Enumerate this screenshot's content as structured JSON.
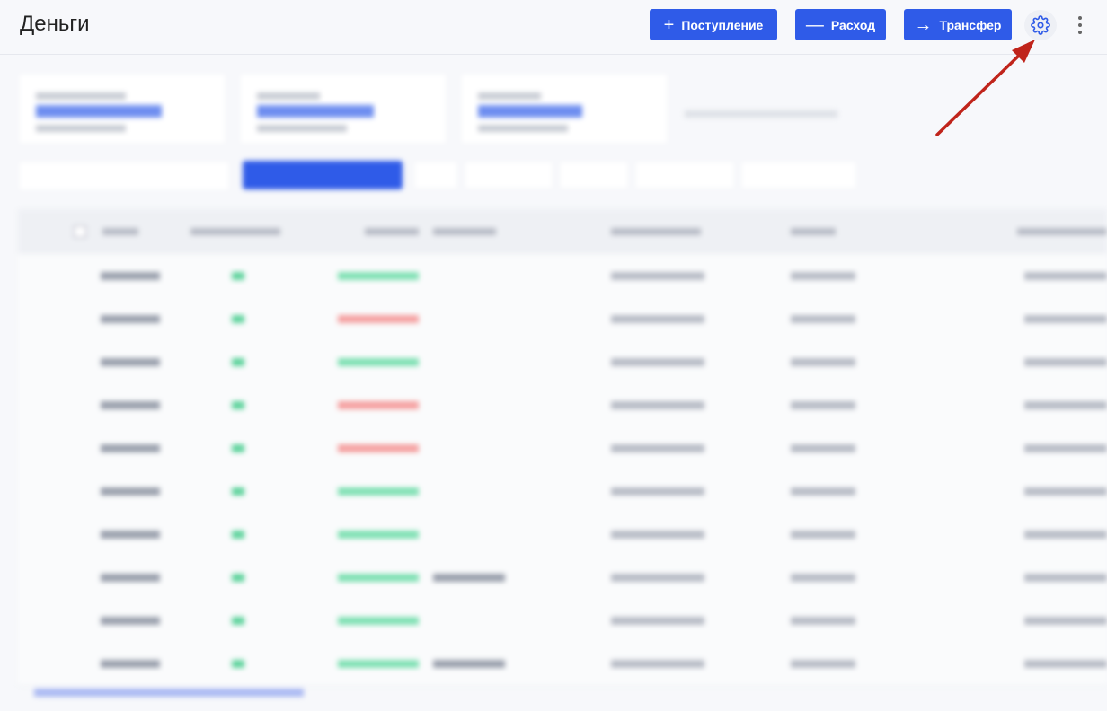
{
  "header": {
    "title": "Деньги",
    "buttons": {
      "income": "Поступление",
      "expense": "Расход",
      "transfer": "Трансфер"
    }
  },
  "colors": {
    "accent": "#2f5be8",
    "annotation_arrow": "#c0241b",
    "positive": "#23b574",
    "negative": "#ee4d4d"
  },
  "icons": {
    "settings": "gear-icon",
    "more": "kebab-menu-icon"
  }
}
